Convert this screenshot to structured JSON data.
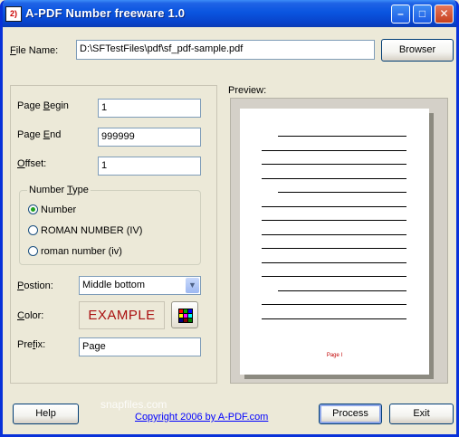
{
  "window": {
    "title": "A-PDF Number freeware 1.0",
    "app_icon_text": "2)",
    "minimize_glyph": "–",
    "maximize_glyph": "□",
    "close_glyph": "✕"
  },
  "file": {
    "label_prefix": "",
    "label_hotkey": "F",
    "label_rest": "ile Name:",
    "value": "D:\\SFTestFiles\\pdf\\sf_pdf-sample.pdf",
    "browse_label": "Browser"
  },
  "fields": {
    "page_begin": {
      "pre": "Page ",
      "hot": "B",
      "post": "egin",
      "value": "1"
    },
    "page_end": {
      "pre": "Page ",
      "hot": "E",
      "post": "nd",
      "value": "999999"
    },
    "offset": {
      "pre": "",
      "hot": "O",
      "post": "ffset:",
      "value": "1"
    }
  },
  "number_type": {
    "legend_pre": "Number ",
    "legend_hot": "T",
    "legend_post": "ype",
    "options": [
      "Number",
      "ROMAN NUMBER (IV)",
      "roman number (iv)"
    ],
    "selected": 0
  },
  "position": {
    "label_pre": "",
    "label_hot": "P",
    "label_post": "ostion:",
    "value": "Middle bottom"
  },
  "color": {
    "label_pre": "",
    "label_hot": "C",
    "label_post": "olor:",
    "example_text": "EXAMPLE",
    "example_color": "#aa1010",
    "palette": [
      "#ff0000",
      "#00aa00",
      "#0000ff",
      "#ffff00",
      "#ff00ff",
      "#00ffff",
      "#000080",
      "#800000",
      "#008000"
    ]
  },
  "prefix": {
    "label_pre": "Pre",
    "label_hot": "f",
    "label_post": "ix:",
    "value": "Page"
  },
  "preview": {
    "label": "Preview:",
    "page_number_text": "Page I"
  },
  "footer": {
    "help_label": "Help",
    "copyright_link": "Copyright 2006 by A-PDF.com",
    "watermark": "snapfiles.com",
    "process_label": "Process",
    "exit_label": "Exit"
  },
  "colors": {
    "titlebar": "#0a55e0",
    "window_bg": "#ece9d8",
    "radio_dot": "#21a121",
    "link": "#0000ff"
  }
}
